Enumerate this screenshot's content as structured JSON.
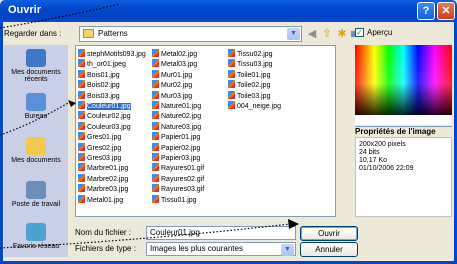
{
  "window": {
    "title": "Ouvrir",
    "help_glyph": "?",
    "close_glyph": "✕"
  },
  "toolbar": {
    "lookin_label": "Regarder dans :",
    "lookin_value": "Patterns",
    "back_glyph": "◀",
    "up_glyph": "⇧",
    "newfolder_glyph": "✱",
    "views_glyph": "▦▾"
  },
  "places": [
    {
      "label": "Mes documents récents"
    },
    {
      "label": "Bureau"
    },
    {
      "label": "Mes documents"
    },
    {
      "label": "Poste de travail"
    },
    {
      "label": "Favoris réseau"
    }
  ],
  "files": [
    [
      "stephMotifs093.jpg",
      "th_or01.jpeg",
      "Bois01.jpg",
      "Bois02.jpg",
      "Bois03.jpg",
      "Couleur01.jpg",
      "Couleur02.jpg",
      "Couleur03.jpg",
      "Gres01.jpg",
      "Gres02.jpg",
      "Gres03.jpg",
      "Marbre01.jpg",
      "Marbre02.jpg",
      "Marbre03.jpg",
      "Metal01.jpg"
    ],
    [
      "Metal02.jpg",
      "Metal03.jpg",
      "Mur01.jpg",
      "Mur02.jpg",
      "Mur03.jpg",
      "Nature01.jpg",
      "Nature02.jpg",
      "Nature03.jpg",
      "Papier01.jpg",
      "Papier02.jpg",
      "Papier03.jpg",
      "Rayures01.gif",
      "Rayures02.gif",
      "Rayures03.gif",
      "Tissu01.jpg"
    ],
    [
      "Tissu02.jpg",
      "Tissu03.jpg",
      "Toile01.jpg",
      "Toile02.jpg",
      "Toile03.jpg",
      "004_neige.jpg"
    ]
  ],
  "selected_file": "Couleur01.jpg",
  "preview": {
    "checkbox_label": "Aperçu",
    "checked": true,
    "props_title": "Propriétés de l'image",
    "props": [
      "200x200 pixels",
      "24 bits",
      "10,17 Ko",
      "01/10/2006 22:09"
    ]
  },
  "filename": {
    "label": "Nom du fichier :",
    "value": "Couleur01.jpg"
  },
  "filetype": {
    "label": "Fichiers de type :",
    "value": "Images les plus courantes"
  },
  "buttons": {
    "open": "Ouvrir",
    "cancel": "Annuler"
  },
  "colors": {
    "title_blue": "#0347c9",
    "selection": "#316ac5",
    "places_bg": "#c8cfe6"
  }
}
